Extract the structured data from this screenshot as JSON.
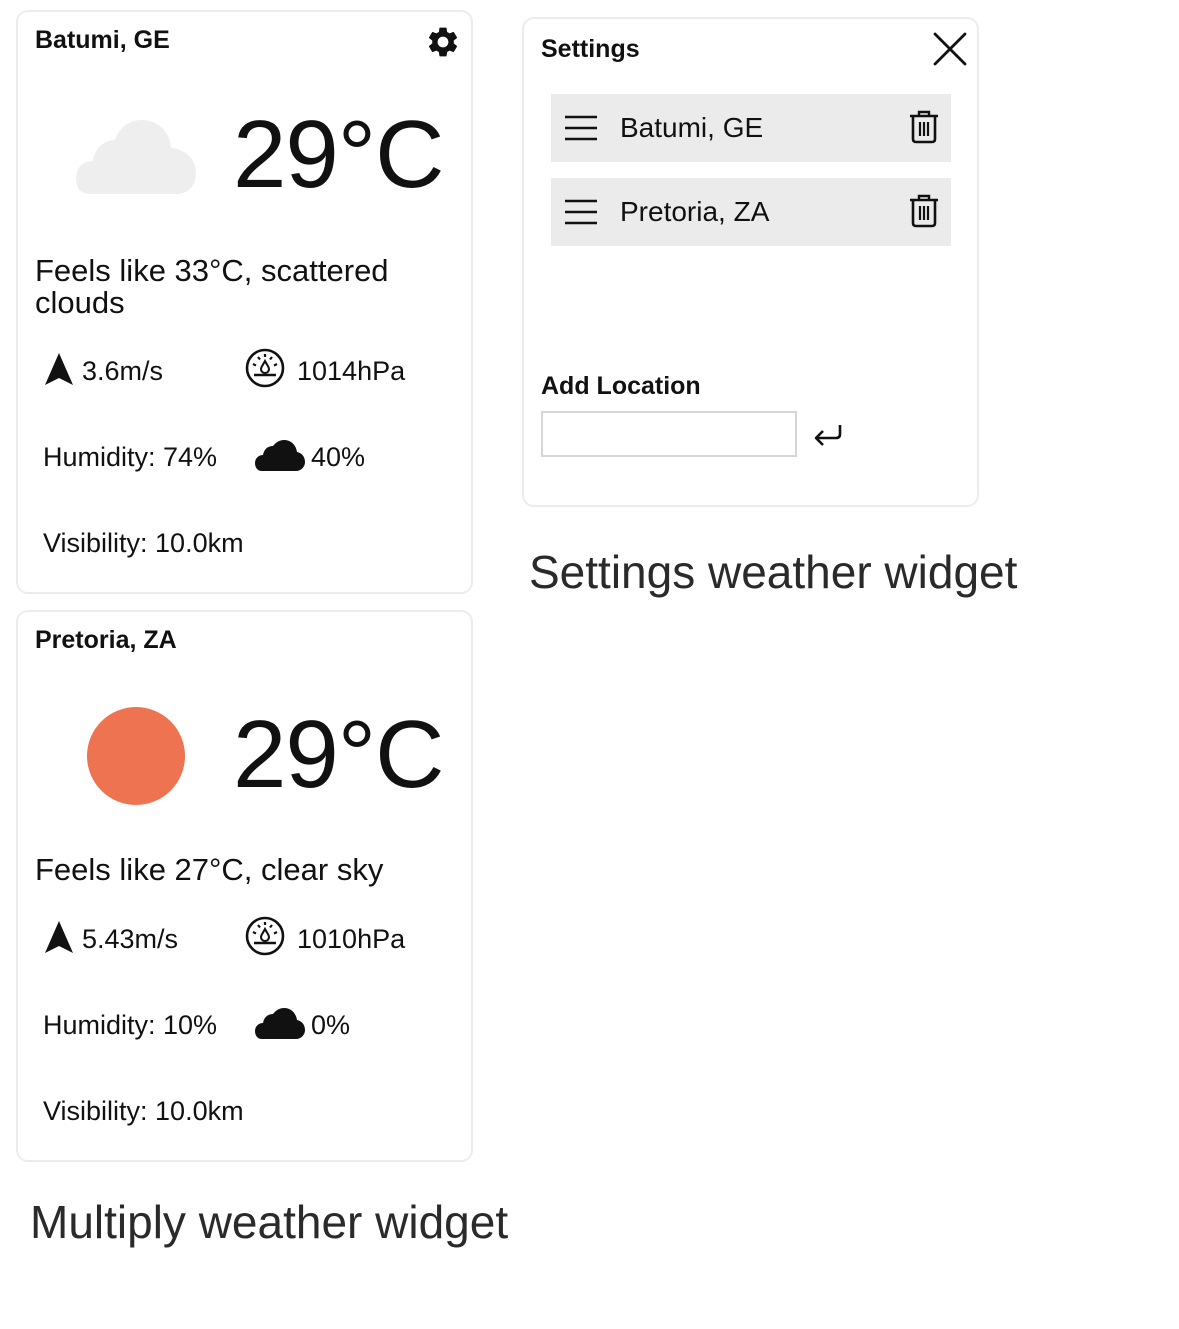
{
  "weather_cards": [
    {
      "city": "Batumi, GE",
      "temp": "29°C",
      "condition_icon": "cloud-icon",
      "feels": "Feels like 33°C, scattered clouds",
      "wind": "3.6m/s",
      "pressure": "1014hPa",
      "humidity": "Humidity: 74%",
      "clouds": "40%",
      "visibility": "Visibility: 10.0km"
    },
    {
      "city": "Pretoria, ZA",
      "temp": "29°C",
      "condition_icon": "sun-icon",
      "feels": "Feels like 27°C, clear sky",
      "wind": "5.43m/s",
      "pressure": "1010hPa",
      "humidity": "Humidity: 10%",
      "clouds": "0%",
      "visibility": "Visibility: 10.0km"
    }
  ],
  "settings": {
    "title": "Settings",
    "locations": [
      "Batumi, GE",
      "Pretoria, ZA"
    ],
    "add_label": "Add Location",
    "input_value": "",
    "input_placeholder": ""
  },
  "captions": {
    "settings": "Settings weather widget",
    "multiply": "Multiply weather widget"
  },
  "colors": {
    "sun": "#ee7350",
    "cloud_light": "#eeeeee",
    "row_bg": "#ebebeb",
    "card_border": "#ececec"
  }
}
